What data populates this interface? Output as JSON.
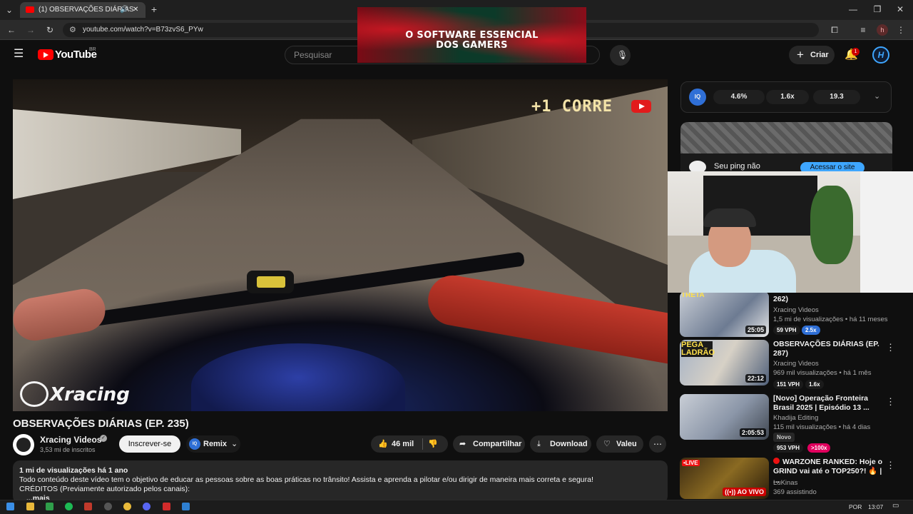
{
  "browser": {
    "tab_title": "(1) OBSERVAÇÕES DIÁRIAS",
    "url": "youtube.com/watch?v=B73zvS6_PYw",
    "profile_initial": "h"
  },
  "banner_ad": {
    "text_line1": "O SOFTWARE ESSENCIAL",
    "text_line2": "DOS GAMERS"
  },
  "youtube": {
    "logo_text": "YouTube",
    "country": "BR",
    "search_placeholder": "Pesquisar",
    "create_label": "Criar",
    "notification_count": "1"
  },
  "video": {
    "overlay_text": "+1 CORRE",
    "watermark": "racing",
    "title": "OBSERVAÇÕES DIÁRIAS (EP. 235)",
    "channel_name": "Xracing Videos",
    "subscribers": "3,53 mi de inscritos",
    "subscribe_label": "Inscrever-se",
    "remix_label": "Remix",
    "likes": "46 mil",
    "share_label": "Compartilhar",
    "download_label": "Download",
    "thanks_label": "Valeu"
  },
  "description": {
    "stats": "1 mi de visualizações  há 1 ano",
    "line1": "Todo conteúdo deste vídeo tem o objetivo de educar as pessoas sobre as boas práticas no trânsito! Assista e aprenda a pilotar e/ou dirigir de maneira mais correta e segura!",
    "line2": "CRÉDITOS (Previamente autorizado pelos canais):",
    "more": "...mais"
  },
  "extension_bar": {
    "logo": "IQ",
    "stat1": "4.6%",
    "stat2": "1.6x",
    "stat3": "19.3"
  },
  "ad_card": {
    "text": "Seu ping não",
    "button": "Acessar o site"
  },
  "recommendations": [
    {
      "title": "262)",
      "channel": "Xracing Videos",
      "meta": "1,5 mi de visualizações • há 11 meses",
      "duration": "25:05",
      "thumb_text": "TRETA",
      "vph": "59 VPH",
      "mult": "2.5x",
      "mult_color": "#2f6fd6"
    },
    {
      "title": "OBSERVAÇÕES DIÁRIAS (EP. 287)",
      "channel": "Xracing Videos",
      "meta": "969 mil visualizações • há 1 mês",
      "duration": "22:12",
      "thumb_text": "PEGA LADRÃO",
      "vph": "151 VPH",
      "mult": "1.6x",
      "mult_color": "#1b1b1b"
    },
    {
      "title": "[Novo] Operação Fronteira Brasil 2025 | Episódio 13 ...",
      "channel": "Khadija Editing",
      "meta": "115 mil visualizações • há 4 dias",
      "duration": "2:05:53",
      "new_label": "Novo",
      "vph": "953 VPH",
      "mult": ">100x",
      "mult_color": "#e1005e"
    },
    {
      "title": "WARZONE RANKED: Hoje o GRIND vai até o TOP250?! 🔥 | ...",
      "channel": "LuKinas",
      "meta": "369 assistindo",
      "live_label": "AO VIVO",
      "thumb_text": "•LIVE"
    }
  ],
  "taskbar": {
    "lang": "POR",
    "time": "13:07"
  },
  "colors": {
    "youtube_red": "#ff0000",
    "accent_blue": "#3ea6ff"
  }
}
